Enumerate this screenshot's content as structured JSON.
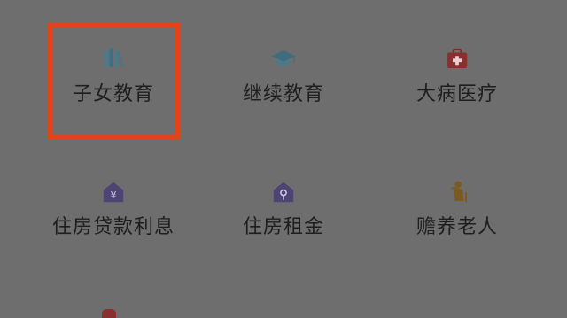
{
  "highlight_color": "#e2431d",
  "items": [
    {
      "label": "子女教育",
      "icon": "books-icon"
    },
    {
      "label": "继续教育",
      "icon": "graduation-cap-icon"
    },
    {
      "label": "大病医疗",
      "icon": "medical-kit-icon"
    },
    {
      "label": "住房贷款利息",
      "icon": "house-yuan-icon"
    },
    {
      "label": "住房租金",
      "icon": "house-key-icon"
    },
    {
      "label": "赡养老人",
      "icon": "elderly-person-icon"
    }
  ],
  "highlighted_item": "子女教育"
}
